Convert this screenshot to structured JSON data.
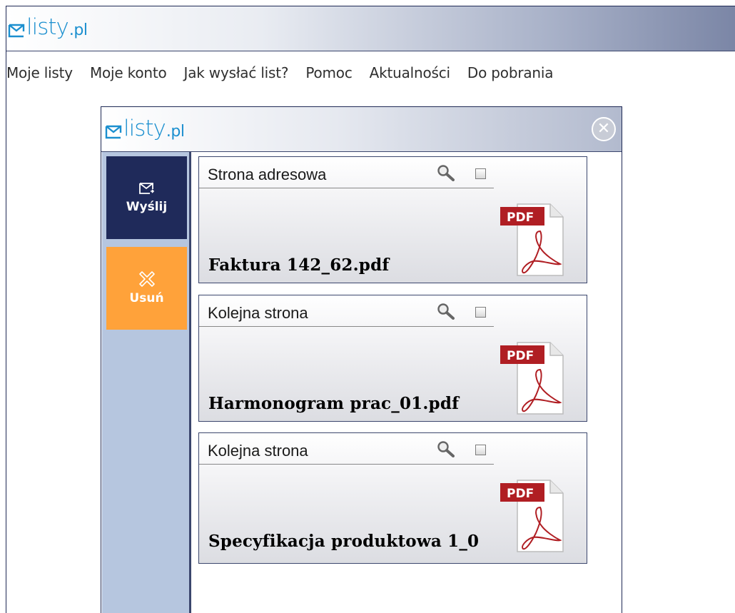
{
  "app": {
    "brand_name": "listy",
    "brand_domain": ".pl",
    "accent": "#1b8fcf"
  },
  "nav": {
    "items": [
      "Moje listy",
      "Moje konto",
      "Jak wysłać list?",
      "Pomoc",
      "Aktualności",
      "Do pobrania"
    ]
  },
  "dialog": {
    "brand_name": "listy",
    "brand_domain": ".pl",
    "close_icon": "close-circle-icon",
    "actions": {
      "send_label": "Wyślij",
      "send_color": "#1f2a5a",
      "delete_label": "Usuń",
      "delete_color": "#ffa23a"
    },
    "documents": [
      {
        "page_type": "Strona adresowa",
        "file_name": "Faktura 142_62.pdf",
        "icon": "pdf-file-icon",
        "checked": false
      },
      {
        "page_type": "Kolejna strona",
        "file_name": "Harmonogram prac_01.pdf",
        "icon": "pdf-file-icon",
        "checked": false
      },
      {
        "page_type": "Kolejna strona",
        "file_name": "Specyfikacja produktowa 1_0",
        "icon": "pdf-file-icon",
        "checked": false
      }
    ]
  }
}
